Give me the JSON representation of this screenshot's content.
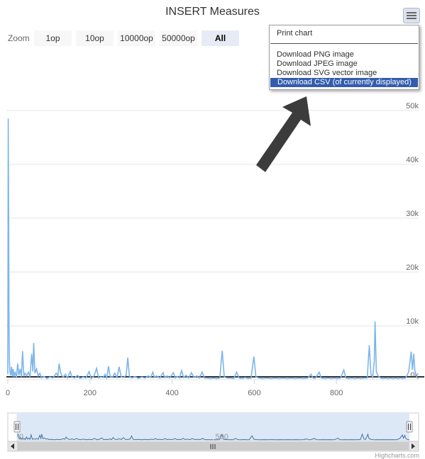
{
  "title": "INSERT Measures",
  "rangeSelector": {
    "label": "Zoom",
    "buttons": [
      "1op",
      "10op",
      "10000op",
      "50000op",
      "All"
    ],
    "selected": "All"
  },
  "exportMenu": {
    "button_icon": "hamburger-menu-icon",
    "items": [
      "Print chart",
      "Download PNG image",
      "Download JPEG image",
      "Download SVG vector image",
      "Download CSV (of currently displayed)"
    ],
    "highlighted": "Download CSV (of currently displayed)"
  },
  "annotation": {
    "icon": "arrow-pointer-icon",
    "color": "#3c3c3c"
  },
  "credits": "Highcharts.com",
  "colors": {
    "series": "#7cb5ec",
    "navigatorMask": "#dce8f6",
    "grid": "#e6e6e6"
  },
  "chart_data": {
    "type": "line",
    "title": "INSERT Measures",
    "xlabel": "",
    "ylabel": "",
    "xlim": [
      0,
      1000
    ],
    "ylim": [
      0,
      50000
    ],
    "yticks": [
      0,
      10000,
      20000,
      30000,
      40000,
      50000
    ],
    "yticklabels": [
      "0k",
      "10k",
      "20k",
      "30k",
      "40k",
      "50k"
    ],
    "xticks": [
      0,
      200,
      400,
      600,
      800
    ],
    "xticklabels": [
      "0",
      "200",
      "400",
      "600",
      "800"
    ],
    "grid": true,
    "legend": "none",
    "series": [
      {
        "values": [
          [
            0,
            1000
          ],
          [
            1,
            48500
          ],
          [
            2,
            30000
          ],
          [
            3,
            10000
          ],
          [
            4,
            3500
          ],
          [
            5,
            1500
          ],
          [
            7,
            800
          ],
          [
            9,
            2400
          ],
          [
            11,
            600
          ],
          [
            13,
            2000
          ],
          [
            15,
            500
          ],
          [
            18,
            1500
          ],
          [
            21,
            300
          ],
          [
            24,
            3000
          ],
          [
            27,
            800
          ],
          [
            30,
            2000
          ],
          [
            33,
            500
          ],
          [
            36,
            5300
          ],
          [
            39,
            600
          ],
          [
            42,
            1200
          ],
          [
            46,
            700
          ],
          [
            50,
            1400
          ],
          [
            54,
            500
          ],
          [
            58,
            4800
          ],
          [
            61,
            1500
          ],
          [
            63,
            6800
          ],
          [
            66,
            1200
          ],
          [
            70,
            2000
          ],
          [
            74,
            700
          ],
          [
            78,
            1200
          ],
          [
            82,
            300
          ],
          [
            88,
            600
          ],
          [
            95,
            200
          ],
          [
            103,
            500
          ],
          [
            110,
            300
          ],
          [
            118,
            1200
          ],
          [
            122,
            700
          ],
          [
            125,
            3000
          ],
          [
            128,
            1500
          ],
          [
            131,
            800
          ],
          [
            135,
            500
          ],
          [
            140,
            1000
          ],
          [
            145,
            300
          ],
          [
            152,
            1500
          ],
          [
            156,
            500
          ],
          [
            162,
            300
          ],
          [
            170,
            800
          ],
          [
            176,
            200
          ],
          [
            183,
            500
          ],
          [
            190,
            300
          ],
          [
            198,
            1500
          ],
          [
            203,
            200
          ],
          [
            210,
            700
          ],
          [
            216,
            2100
          ],
          [
            221,
            300
          ],
          [
            226,
            500
          ],
          [
            232,
            400
          ],
          [
            237,
            1000
          ],
          [
            241,
            300
          ],
          [
            245,
            2500
          ],
          [
            249,
            600
          ],
          [
            255,
            400
          ],
          [
            260,
            1200
          ],
          [
            266,
            400
          ],
          [
            271,
            2400
          ],
          [
            276,
            500
          ],
          [
            282,
            400
          ],
          [
            288,
            800
          ],
          [
            292,
            4100
          ],
          [
            296,
            600
          ],
          [
            302,
            300
          ],
          [
            310,
            600
          ],
          [
            318,
            200
          ],
          [
            326,
            500
          ],
          [
            334,
            300
          ],
          [
            342,
            700
          ],
          [
            348,
            400
          ],
          [
            353,
            1400
          ],
          [
            357,
            400
          ],
          [
            362,
            700
          ],
          [
            370,
            300
          ],
          [
            378,
            1300
          ],
          [
            382,
            400
          ],
          [
            388,
            700
          ],
          [
            394,
            300
          ],
          [
            403,
            1300
          ],
          [
            408,
            300
          ],
          [
            412,
            600
          ],
          [
            418,
            300
          ],
          [
            423,
            1700
          ],
          [
            428,
            400
          ],
          [
            434,
            800
          ],
          [
            440,
            300
          ],
          [
            447,
            1300
          ],
          [
            453,
            400
          ],
          [
            460,
            700
          ],
          [
            466,
            300
          ],
          [
            473,
            1400
          ],
          [
            479,
            300
          ],
          [
            486,
            300
          ],
          [
            494,
            200
          ],
          [
            501,
            300
          ],
          [
            508,
            200
          ],
          [
            516,
            300
          ],
          [
            522,
            5400
          ],
          [
            527,
            500
          ],
          [
            534,
            300
          ],
          [
            542,
            300
          ],
          [
            550,
            200
          ],
          [
            557,
            1400
          ],
          [
            563,
            300
          ],
          [
            570,
            200
          ],
          [
            578,
            400
          ],
          [
            585,
            200
          ],
          [
            592,
            300
          ],
          [
            599,
            4300
          ],
          [
            604,
            500
          ],
          [
            612,
            300
          ],
          [
            620,
            200
          ],
          [
            630,
            300
          ],
          [
            640,
            200
          ],
          [
            650,
            300
          ],
          [
            660,
            200
          ],
          [
            670,
            300
          ],
          [
            680,
            200
          ],
          [
            690,
            300
          ],
          [
            700,
            200
          ],
          [
            710,
            300
          ],
          [
            720,
            200
          ],
          [
            730,
            300
          ],
          [
            738,
            1000
          ],
          [
            743,
            300
          ],
          [
            748,
            200
          ],
          [
            758,
            1400
          ],
          [
            763,
            300
          ],
          [
            772,
            200
          ],
          [
            780,
            300
          ],
          [
            788,
            200
          ],
          [
            795,
            300
          ],
          [
            803,
            200
          ],
          [
            810,
            300
          ],
          [
            818,
            1800
          ],
          [
            823,
            300
          ],
          [
            830,
            200
          ],
          [
            838,
            300
          ],
          [
            845,
            200
          ],
          [
            852,
            300
          ],
          [
            860,
            200
          ],
          [
            868,
            300
          ],
          [
            875,
            300
          ],
          [
            880,
            6400
          ],
          [
            884,
            1000
          ],
          [
            888,
            400
          ],
          [
            892,
            3500
          ],
          [
            894,
            10800
          ],
          [
            897,
            1500
          ],
          [
            902,
            600
          ],
          [
            908,
            300
          ],
          [
            914,
            200
          ],
          [
            920,
            300
          ],
          [
            926,
            200
          ],
          [
            932,
            300
          ],
          [
            938,
            200
          ],
          [
            944,
            300
          ],
          [
            950,
            200
          ],
          [
            956,
            300
          ],
          [
            962,
            200
          ],
          [
            968,
            300
          ],
          [
            972,
            800
          ],
          [
            976,
            1500
          ],
          [
            980,
            4000
          ],
          [
            982,
            5200
          ],
          [
            985,
            1800
          ],
          [
            988,
            4800
          ],
          [
            991,
            1500
          ],
          [
            994,
            700
          ],
          [
            997,
            300
          ],
          [
            1000,
            200
          ]
        ]
      }
    ],
    "navigator": {
      "xlim": [
        0,
        1000
      ],
      "ticklabels": [
        "0",
        "500"
      ],
      "selection": [
        0,
        1000
      ]
    }
  }
}
